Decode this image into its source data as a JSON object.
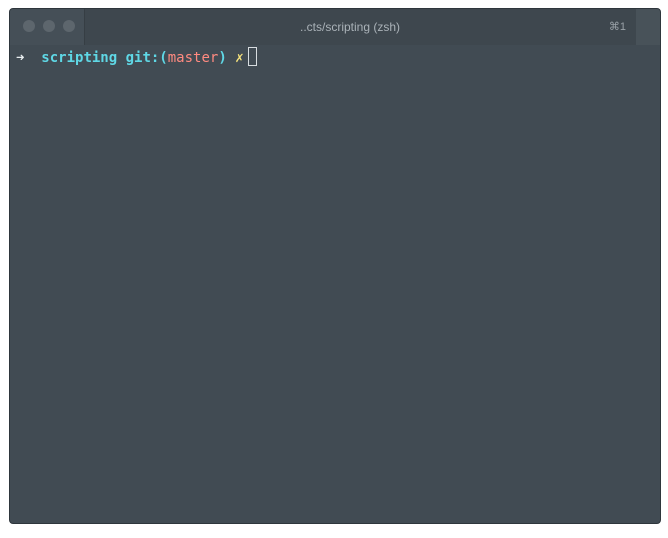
{
  "window": {
    "title": "..cts/scripting (zsh)",
    "shortcut": "⌘1"
  },
  "terminal": {
    "prompt": {
      "arrow": "➜",
      "directory": "scripting",
      "git_prefix": "git:(",
      "branch": "master",
      "git_suffix": ")",
      "dirty_marker": "✗"
    }
  },
  "colors": {
    "background": "#414b53",
    "directory": "#5fd8e6",
    "branch": "#ff8a80",
    "dirty": "#f6e27c"
  }
}
